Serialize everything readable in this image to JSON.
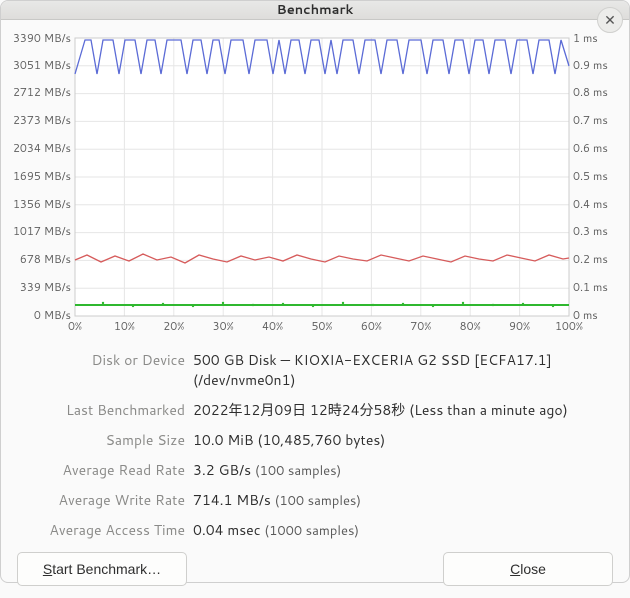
{
  "window": {
    "title": "Benchmark"
  },
  "chart_data": {
    "type": "line",
    "xlabel_pct": [
      "0%",
      "10%",
      "20%",
      "30%",
      "40%",
      "50%",
      "60%",
      "70%",
      "80%",
      "90%",
      "100%"
    ],
    "y_left_label_unit": "MB/s",
    "y_left_ticks": [
      0,
      339,
      678,
      1017,
      1356,
      1695,
      2034,
      2373,
      2712,
      3051,
      3390
    ],
    "y_right_label_unit": "ms",
    "y_right_ticks": [
      "0 ms",
      "0.1 ms",
      "0.2 ms",
      "0.3 ms",
      "0.4 ms",
      "0.5 ms",
      "0.6 ms",
      "0.7 ms",
      "0.8 ms",
      "0.9 ms",
      "1 ms"
    ],
    "series": [
      {
        "name": "read",
        "color": "#5b6bd6",
        "approx_avg_mbps": 3200,
        "range_mbps": [
          2900,
          3390
        ]
      },
      {
        "name": "write",
        "color": "#d65b5b",
        "approx_avg_mbps": 714,
        "range_mbps": [
          600,
          780
        ]
      },
      {
        "name": "access",
        "color": "#2fb82f",
        "approx_avg_ms": 0.04,
        "range_ms": [
          0.02,
          0.06
        ]
      }
    ],
    "ylim_left": [
      0,
      3390
    ],
    "ylim_right": [
      0,
      1
    ]
  },
  "info": {
    "labels": {
      "disk": "Disk or Device",
      "last": "Last Benchmarked",
      "sample": "Sample Size",
      "read": "Average Read Rate",
      "write": "Average Write Rate",
      "access": "Average Access Time"
    },
    "disk": "500 GB Disk — KIOXIA-EXCERIA G2 SSD [ECFA17.1] (/dev/nvme0n1)",
    "last": "2022年12月09日 12時24分58秒 (Less than a minute ago)",
    "sample": "10.0 MiB (10,485,760 bytes)",
    "read_main": "3.2 GB/s ",
    "read_sub": "(100 samples)",
    "write_main": "714.1 MB/s ",
    "write_sub": "(100 samples)",
    "access_main": "0.04 msec ",
    "access_sub": "(1000 samples)"
  },
  "buttons": {
    "start_pre": "S",
    "start_post": "tart Benchmark…",
    "close_pre": "C",
    "close_post": "lose"
  }
}
